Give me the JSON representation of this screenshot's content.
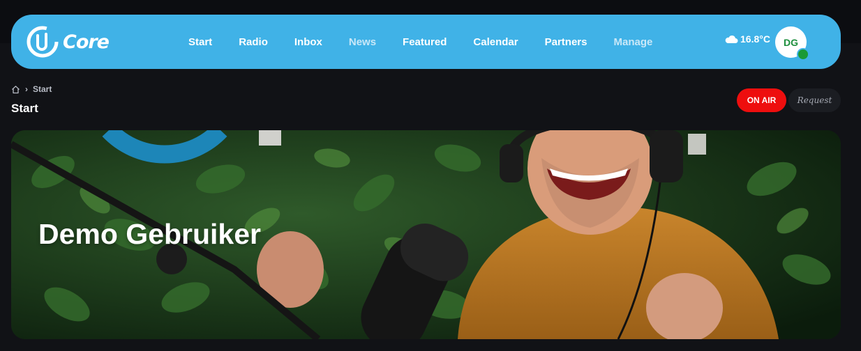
{
  "brand": {
    "logo_text": "Core"
  },
  "nav": {
    "items": [
      {
        "label": "Start",
        "dim": false
      },
      {
        "label": "Radio",
        "dim": false
      },
      {
        "label": "Inbox",
        "dim": false
      },
      {
        "label": "News",
        "dim": true
      },
      {
        "label": "Featured",
        "dim": false
      },
      {
        "label": "Calendar",
        "dim": false
      },
      {
        "label": "Partners",
        "dim": false
      },
      {
        "label": "Manage",
        "dim": true
      }
    ]
  },
  "weather": {
    "temperature": "16.8°C",
    "icon": "cloud-icon"
  },
  "user": {
    "initials": "DG",
    "status_color": "#1a9a36"
  },
  "breadcrumb": {
    "home_icon": "home-icon",
    "separator": "›",
    "current": "Start"
  },
  "page": {
    "title": "Start"
  },
  "actions": {
    "on_air_label": "ON AIR",
    "request_label": "Request"
  },
  "hero": {
    "title": "Demo Gebruiker"
  },
  "colors": {
    "navbar": "#40b2e7",
    "on_air": "#ee0e0e",
    "background": "#111216"
  }
}
